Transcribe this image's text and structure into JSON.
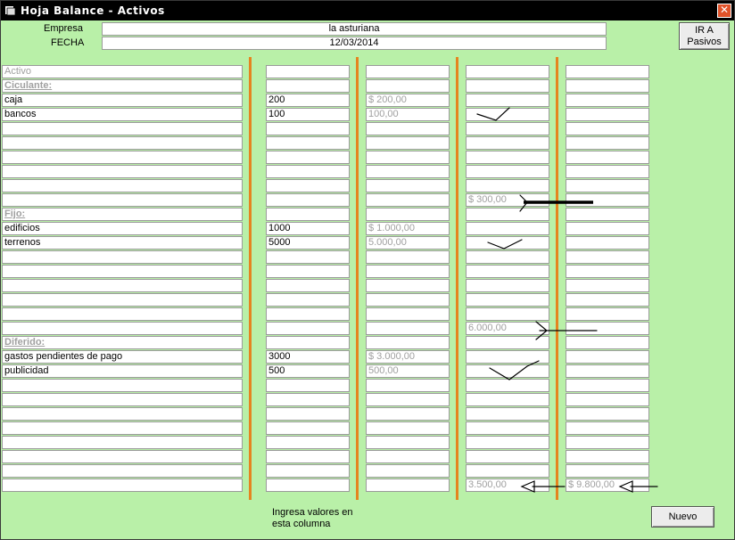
{
  "window": {
    "title": "Hoja Balance  - Activos",
    "close_glyph": "✕"
  },
  "header": {
    "empresa_label": "Empresa",
    "fecha_label": "FECHA",
    "empresa_value": "la asturiana",
    "fecha_value": "12/03/2014"
  },
  "buttons": {
    "ir_pasivos": [
      "IR A",
      "Pasivos"
    ],
    "nuevo": "Nuevo"
  },
  "footer_note": [
    "Ingresa valores en",
    "esta columna"
  ],
  "grid": {
    "rows": [
      {
        "name": "Activo",
        "style": "grey",
        "value": "",
        "formatted": "",
        "subtotal": "",
        "total": ""
      },
      {
        "name": "Ciculante:",
        "style": "header",
        "value": "",
        "formatted": "",
        "subtotal": "",
        "total": ""
      },
      {
        "name": "caja",
        "style": "",
        "value": "200",
        "formatted": "$ 200,00",
        "subtotal": "",
        "total": ""
      },
      {
        "name": "bancos",
        "style": "",
        "value": "100",
        "formatted": "100,00",
        "subtotal": "",
        "total": ""
      },
      {
        "name": "",
        "style": "",
        "value": "",
        "formatted": "",
        "subtotal": "",
        "total": ""
      },
      {
        "name": "",
        "style": "",
        "value": "",
        "formatted": "",
        "subtotal": "",
        "total": ""
      },
      {
        "name": "",
        "style": "",
        "value": "",
        "formatted": "",
        "subtotal": "",
        "total": ""
      },
      {
        "name": "",
        "style": "",
        "value": "",
        "formatted": "",
        "subtotal": "",
        "total": ""
      },
      {
        "name": "",
        "style": "",
        "value": "",
        "formatted": "",
        "subtotal": "",
        "total": ""
      },
      {
        "name": "",
        "style": "",
        "value": "",
        "formatted": "",
        "subtotal": "$ 300,00",
        "total": ""
      },
      {
        "name": "Fijo:",
        "style": "header",
        "value": "",
        "formatted": "",
        "subtotal": "",
        "total": ""
      },
      {
        "name": "edificios",
        "style": "",
        "value": "1000",
        "formatted": "$ 1.000,00",
        "subtotal": "",
        "total": ""
      },
      {
        "name": "terrenos",
        "style": "",
        "value": "5000",
        "formatted": "5.000,00",
        "subtotal": "",
        "total": ""
      },
      {
        "name": "",
        "style": "",
        "value": "",
        "formatted": "",
        "subtotal": "",
        "total": ""
      },
      {
        "name": "",
        "style": "",
        "value": "",
        "formatted": "",
        "subtotal": "",
        "total": ""
      },
      {
        "name": "",
        "style": "",
        "value": "",
        "formatted": "",
        "subtotal": "",
        "total": ""
      },
      {
        "name": "",
        "style": "",
        "value": "",
        "formatted": "",
        "subtotal": "",
        "total": ""
      },
      {
        "name": "",
        "style": "",
        "value": "",
        "formatted": "",
        "subtotal": "",
        "total": ""
      },
      {
        "name": "",
        "style": "",
        "value": "",
        "formatted": "",
        "subtotal": "6.000,00",
        "total": ""
      },
      {
        "name": "Diferido:",
        "style": "header",
        "value": "",
        "formatted": "",
        "subtotal": "",
        "total": ""
      },
      {
        "name": "gastos pendientes de pago",
        "style": "",
        "value": "3000",
        "formatted": "$ 3.000,00",
        "subtotal": "",
        "total": ""
      },
      {
        "name": "publicidad",
        "style": "",
        "value": "500",
        "formatted": "500,00",
        "subtotal": "",
        "total": ""
      },
      {
        "name": "",
        "style": "",
        "value": "",
        "formatted": "",
        "subtotal": "",
        "total": ""
      },
      {
        "name": "",
        "style": "",
        "value": "",
        "formatted": "",
        "subtotal": "",
        "total": ""
      },
      {
        "name": "",
        "style": "",
        "value": "",
        "formatted": "",
        "subtotal": "",
        "total": ""
      },
      {
        "name": "",
        "style": "",
        "value": "",
        "formatted": "",
        "subtotal": "",
        "total": ""
      },
      {
        "name": "",
        "style": "",
        "value": "",
        "formatted": "",
        "subtotal": "",
        "total": ""
      },
      {
        "name": "",
        "style": "",
        "value": "",
        "formatted": "",
        "subtotal": "",
        "total": ""
      },
      {
        "name": "",
        "style": "",
        "value": "",
        "formatted": "",
        "subtotal": "",
        "total": ""
      },
      {
        "name": "",
        "style": "",
        "value": "",
        "formatted": "",
        "subtotal": "3.500,00",
        "total": "$ 9.800,00"
      }
    ]
  },
  "colors": {
    "background": "#b9f0a8",
    "separator": "#e5841f",
    "titlebar": "#000000"
  }
}
